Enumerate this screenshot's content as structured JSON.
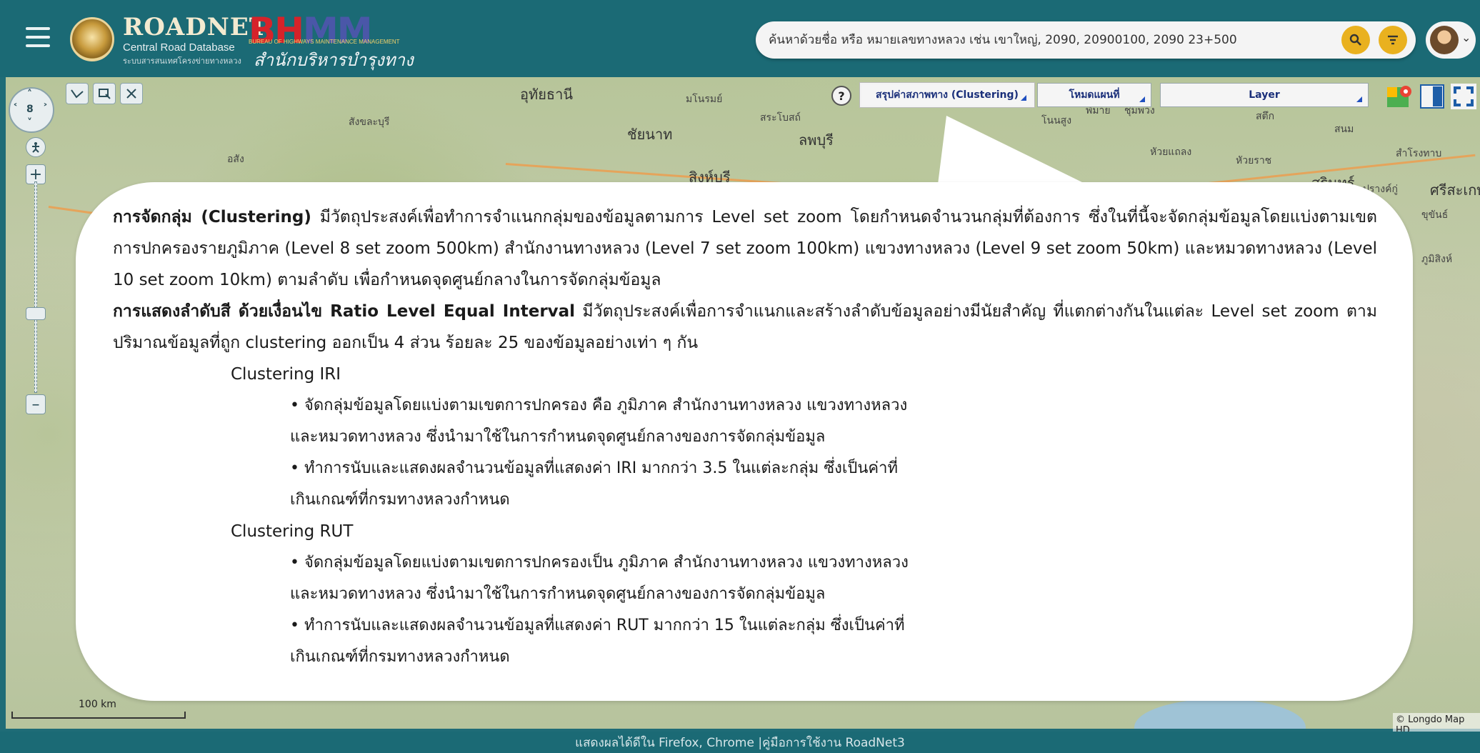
{
  "header": {
    "menu_icon": "hamburger-icon",
    "logo_title": "ROADNET",
    "logo_sub1": "Central Road Database",
    "logo_sub2": "ระบบสารสนเทศโครงข่ายทางหลวง",
    "bhmm_b": "B",
    "bhmm_h": "H",
    "bhmm_mm": "MM",
    "bhmm_sub": "BUREAU OF HIGHWAYS MAINTENANCE MANAGEMENT",
    "bhmm_thai": "สำนักบริหารบำรุงทาง",
    "search_placeholder": "ค้นหาด้วยชื่อ หรือ หมายเลขทางหลวง เช่น เขาใหญ่, 2090, 20900100, 2090 23+500",
    "search_icon": "search-icon",
    "filter_icon": "filter-icon"
  },
  "toolbar": {
    "help_label": "?",
    "clustering_label": "สรุปค่าสภาพทาง (Clustering)",
    "mode_label": "โหมดแผนที่",
    "layer_label": "Layer"
  },
  "map": {
    "labels": [
      "อุทัยธานี",
      "ชัยนาท",
      "มโนรมย์",
      "สระโบสถ์",
      "ลพบุรี",
      "สิงห์บุรี",
      "สังขละบุรี",
      "โนนสูง",
      "พิมาย",
      "ชุมพวง",
      "หัวยแถลง",
      "หัวยราช",
      "สำโรงทาบ",
      "สุรินทร์",
      "ศรีสะเกษ",
      "ปรางค์กู่",
      "ขุขันธ์",
      "อสัง",
      "สนม",
      "สตึก",
      "ภูมิสิงห์"
    ],
    "scale_label": "100 km",
    "credit": "© Longdo Map HD"
  },
  "content": {
    "p1_bold": "การจัดกลุ่ม (Clustering)",
    "p1_text": " มีวัตถุประสงค์เพื่อทำการจำแนกกลุ่มของข้อมูลตามการ Level set zoom โดยกำหนดจำนวนกลุ่มที่ต้องการ ซึ่งในที่นี้จะจัดกลุ่มข้อมูลโดยแบ่งตามเขตการปกครองรายภูมิภาค (Level 8 set zoom 500km) สำนักงานทางหลวง (Level 7 set zoom 100km) แขวงทางหลวง (Level 9 set zoom 50km) และหมวดทางหลวง (Level 10 set zoom 10km) ตามลำดับ เพื่อกำหนดจุดศูนย์กลางในการจัดกลุ่มข้อมูล",
    "p2_bold": "การแสดงลำดับสี ด้วยเงื่อนไข Ratio Level Equal Interval",
    "p2_text": " มีวัตถุประสงค์เพื่อการจำแนกและสร้างลำดับข้อมูลอย่างมีนัยสำคัญ ที่แตกต่างกันในแต่ละ Level set zoom ตามปริมาณข้อมูลที่ถูก clustering ออกเป็น 4 ส่วน ร้อยละ 25 ของข้อมูลอย่างเท่า ๆ กัน",
    "iri_heading": "Clustering IRI",
    "iri_b1_l1": "• จัดกลุ่มข้อมูลโดยแบ่งตามเขตการปกครอง คือ ภูมิภาค สำนักงานทางหลวง แขวงทางหลวง",
    "iri_b1_l2": "และหมวดทางหลวง  ซึ่งนำมาใช้ในการกำหนดจุดศูนย์กลางของการจัดกลุ่มข้อมูล",
    "iri_b2_l1": "•  ทำการนับและแสดงผลจำนวนข้อมูลที่แสดงค่า IRI มากกว่า 3.5 ในแต่ละกลุ่ม ซึ่งเป็นค่าที่",
    "iri_b2_l2": "เกินเกณฑ์ที่กรมทางหลวงกำหนด",
    "rut_heading": "Clustering RUT",
    "rut_b1_l1": "•  จัดกลุ่มข้อมูลโดยแบ่งตามเขตการปกครองเป็น ภูมิภาค สำนักงานทางหลวง แขวงทางหลวง",
    "rut_b1_l2": "และหมวดทางหลวง ซึ่งนำมาใช้ในการกำหนดจุดศูนย์กลางของการจัดกลุ่มข้อมูล",
    "rut_b2_l1": "•   ทำการนับและแสดงผลจำนวนข้อมูลที่แสดงค่า RUT มากกว่า 15 ในแต่ละกลุ่ม ซึ่งเป็นค่าที่",
    "rut_b2_l2": "เกินเกณฑ์ที่กรมทางหลวงกำหนด"
  },
  "footer": {
    "text": "แสดงผลได้ดีใน Firefox, Chrome | ",
    "link": "คู่มือการใช้งาน RoadNet3"
  },
  "colors": {
    "header_bg": "#1b6a75",
    "accent_yellow": "#e9b11f",
    "brand_red": "#d6232a",
    "brand_blue": "#4a57a8"
  }
}
